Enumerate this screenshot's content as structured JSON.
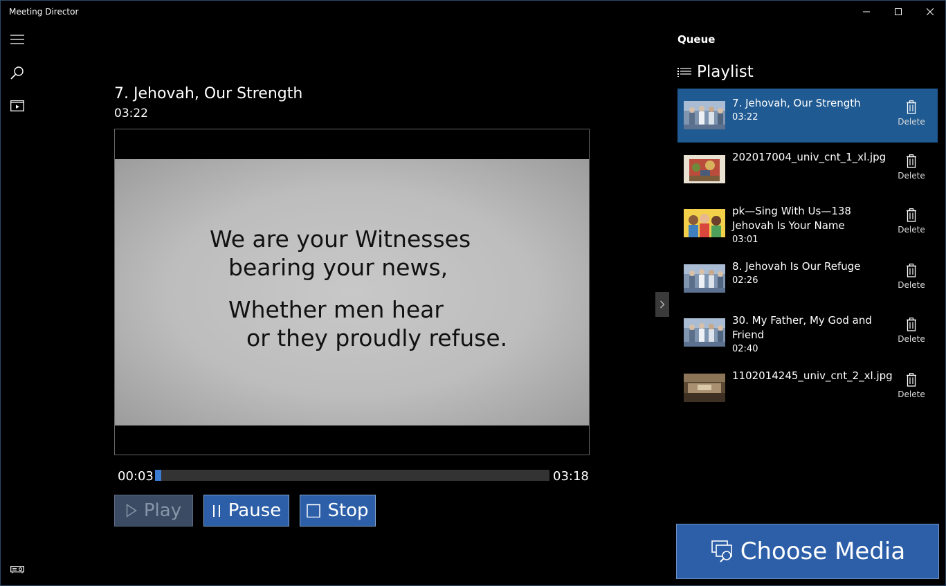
{
  "window": {
    "title": "Meeting Director"
  },
  "main": {
    "media_title": "7. Jehovah, Our Strength",
    "media_duration": "03:22",
    "slide_lines": [
      "We are your Witnesses",
      "bearing your news,",
      "Whether men hear",
      "or they proudly refuse."
    ],
    "time_current": "00:03",
    "time_end": "03:18",
    "progress_fraction": 0.016,
    "play_label": "Play",
    "pause_label": "Pause",
    "stop_label": "Stop"
  },
  "queue": {
    "heading": "Queue",
    "playlist_heading": "Playlist",
    "delete_label": "Delete",
    "items": [
      {
        "title": "7. Jehovah, Our Strength",
        "duration": "03:22",
        "selected": true,
        "thumb": "singers"
      },
      {
        "title": "202017004_univ_cnt_1_xl.jpg",
        "duration": "",
        "selected": false,
        "thumb": "painting"
      },
      {
        "title": "pk—Sing With Us—138 Jehovah Is Your Name",
        "duration": "03:01",
        "selected": false,
        "thumb": "cartoon"
      },
      {
        "title": "8. Jehovah Is Our Refuge",
        "duration": "02:26",
        "selected": false,
        "thumb": "singers"
      },
      {
        "title": "30. My Father, My God and Friend",
        "duration": "02:40",
        "selected": false,
        "thumb": "singers"
      },
      {
        "title": "1102014245_univ_cnt_2_xl.jpg",
        "duration": "",
        "selected": false,
        "thumb": "sepia"
      }
    ],
    "choose_media_label": "Choose Media"
  },
  "colors": {
    "accent": "#2c5fa8",
    "selected_row": "#1f5a92",
    "progress": "#3b7bd1"
  }
}
